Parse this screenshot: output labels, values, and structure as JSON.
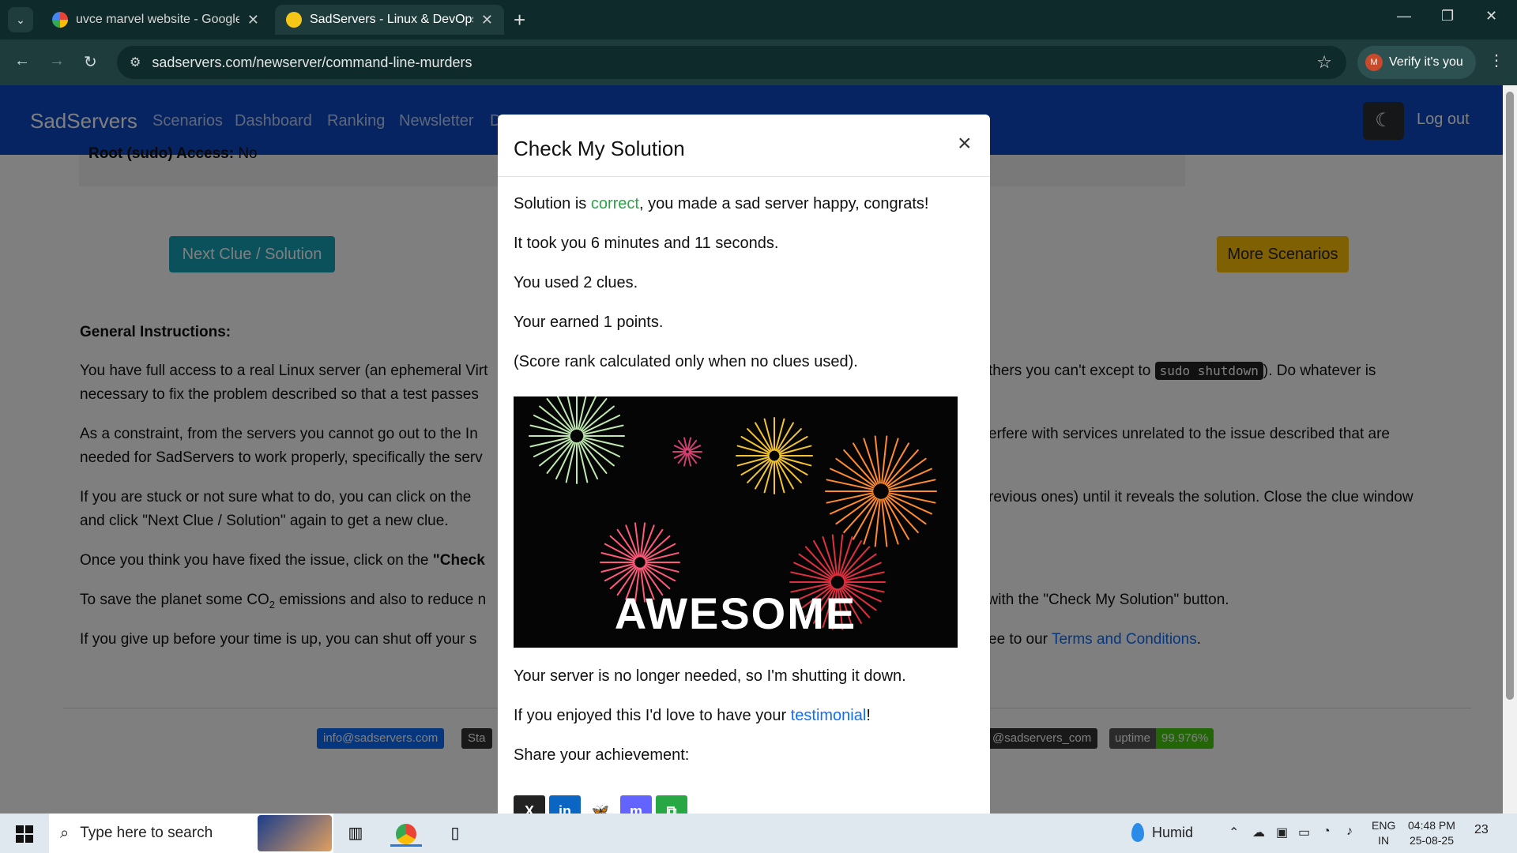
{
  "browser": {
    "tabs": [
      {
        "title": "uvce marvel website - Google S"
      },
      {
        "title": "SadServers - Linux & DevOps Tr"
      }
    ],
    "url": "sadservers.com/newserver/command-line-murders",
    "verify_label": "Verify it's you",
    "profile_initial": "M"
  },
  "site": {
    "brand": "SadServers",
    "nav": [
      "Scenarios",
      "Dashboard",
      "Ranking",
      "Newsletter",
      "D"
    ],
    "logout": "Log out",
    "root_access_label": "Root (sudo) Access:",
    "root_access_value": "No",
    "next_clue_label": "Next Clue / Solution",
    "more_scenarios_label": "More Scenarios",
    "instructions_title": "General Instructions:",
    "para1_a": "You have full access to a real Linux server (an ephemeral Virt",
    "para1_b": "thers you can't except to",
    "para1_code": "sudo shutdown",
    "para1_c": "). Do whatever is",
    "para1_line2": "necessary to fix the problem described so that a test passes",
    "para2_a": "As a constraint, from the servers you cannot go out to the In",
    "para2_b": "erfere with services unrelated to the issue described that are",
    "para2_line2": "needed for SadServers to work properly, specifically the serv",
    "para3_a": "If you are stuck or not sure what to do, you can click on the",
    "para3_b": "revious ones) until it reveals the solution. Close the clue window",
    "para3_line2": "and click \"Next Clue / Solution\" again to get a new clue.",
    "para4_a": "Once you think you have fixed the issue, click on the",
    "para4_bold": "\"Check",
    "para5_a": "To save the planet some CO",
    "para5_sub": "2",
    "para5_b": " emissions and also to reduce n",
    "para5_c": ": with the \"Check My Solution\" button.",
    "para6_a": "If you give up before your time is up, you can shut off your s",
    "para6_b": "ee to our",
    "para6_link": "Terms and Conditions",
    "para6_end": ".",
    "footer_email": "info@sadservers.com",
    "footer_sta": "Sta",
    "footer_handle": "@sadservers_com",
    "uptime_key": "uptime",
    "uptime_value": "99.976%"
  },
  "modal": {
    "title": "Check My Solution",
    "close": "×",
    "result_prefix": "Solution is ",
    "result_word": "correct",
    "result_suffix": ", you made a sad server happy, congrats!",
    "time_taken": "It took you 6 minutes and 11 seconds.",
    "clues_used": "You used 2 clues.",
    "points": "Your earned 1 points.",
    "score_note": "(Score rank calculated only when no clues used).",
    "image_text": "AWESOME",
    "shutdown_note": "Your server is no longer needed, so I'm shutting it down.",
    "testimonial_prefix": "If you enjoyed this I'd love to have your ",
    "testimonial_link": "testimonial",
    "testimonial_suffix": "!",
    "share_label": "Share your achievement:",
    "share_buttons": [
      {
        "icon": "x-icon",
        "glyph": "X",
        "color": "#222222"
      },
      {
        "icon": "linkedin-icon",
        "glyph": "in",
        "color": "#0a66c2"
      },
      {
        "icon": "bluesky-icon",
        "glyph": "🦋",
        "color": "#ffffff"
      },
      {
        "icon": "mastodon-icon",
        "glyph": "m",
        "color": "#6364ff"
      },
      {
        "icon": "copy-icon",
        "glyph": "⧉",
        "color": "#28a745"
      }
    ]
  },
  "taskbar": {
    "search_placeholder": "Type here to search",
    "weather": "Humid",
    "lang_line1": "ENG",
    "lang_line2": "IN",
    "time": "04:48 PM",
    "date": "25-08-25",
    "notifications": "23"
  }
}
